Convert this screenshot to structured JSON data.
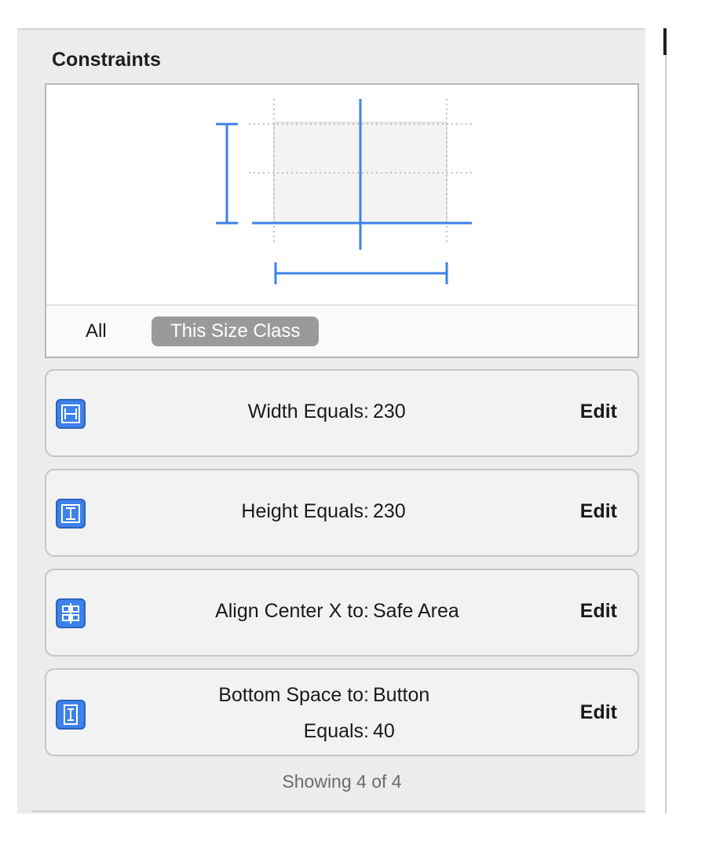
{
  "section": {
    "title": "Constraints"
  },
  "segments": {
    "all": "All",
    "this_size_class": "This Size Class"
  },
  "constraints": [
    {
      "icon": "width-constraint-icon",
      "label": "Width Equals:",
      "value": "230",
      "edit": "Edit"
    },
    {
      "icon": "height-constraint-icon",
      "label": "Height Equals:",
      "value": "230",
      "edit": "Edit"
    },
    {
      "icon": "align-center-x-icon",
      "label": "Align Center X to:",
      "value": "Safe Area",
      "edit": "Edit"
    },
    {
      "icon": "bottom-space-icon",
      "label": "Bottom Space to:",
      "value": "Button",
      "label2": "Equals:",
      "value2": "40",
      "edit": "Edit"
    }
  ],
  "footer": {
    "count_text": "Showing 4 of 4"
  },
  "colors": {
    "accent": "#3d82ea",
    "panel": "#ececec",
    "segment_selected": "#9a9a9a"
  }
}
